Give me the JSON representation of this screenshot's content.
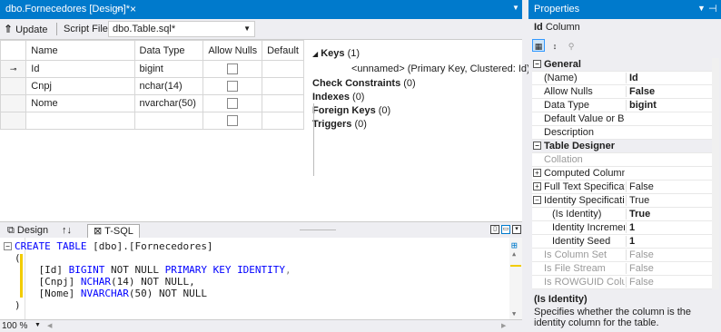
{
  "document_tab": {
    "label": "dbo.Fornecedores [Design]*",
    "pin_glyph": "⇔",
    "close_glyph": "×"
  },
  "toolbar": {
    "update_label": "Update",
    "script_file_label": "Script File:",
    "script_file_value": "dbo.Table.sql*"
  },
  "grid": {
    "columns": [
      "Name",
      "Data Type",
      "Allow Nulls",
      "Default"
    ],
    "rows": [
      {
        "name": "Id",
        "type": "bigint",
        "key": true
      },
      {
        "name": "Cnpj",
        "type": "nchar(14)",
        "key": false
      },
      {
        "name": "Nome",
        "type": "nvarchar(50)",
        "key": false
      },
      {
        "name": "",
        "type": "",
        "key": false
      }
    ]
  },
  "table_props": {
    "keys_label": "Keys",
    "keys_count": "(1)",
    "key_item": "<unnamed>   (Primary Key, Clustered: Id)",
    "check_label": "Check Constraints",
    "check_count": "(0)",
    "indexes_label": "Indexes",
    "indexes_count": "(0)",
    "fk_label": "Foreign Keys",
    "fk_count": "(0)",
    "triggers_label": "Triggers",
    "triggers_count": "(0)"
  },
  "pane_tabs": {
    "design": "Design",
    "swap": "↑↓",
    "tsql": "T-SQL"
  },
  "code": {
    "line1_kw": "CREATE TABLE",
    "line1_rest": " [dbo].[Fornecedores]",
    "line2": "(",
    "line3_a": "    [Id] ",
    "line3_kw": "BIGINT",
    "line3_b": " NOT NULL ",
    "line3_kw2": "PRIMARY KEY IDENTITY",
    "line3_c": ",",
    "line4_a": "    [Cnpj] ",
    "line4_kw": "NCHAR",
    "line4_b": "(14) NOT NULL,",
    "line5_a": "    [Nome] ",
    "line5_kw": "NVARCHAR",
    "line5_b": "(50) NOT NULL",
    "line6": ")"
  },
  "status": {
    "zoom": "100 %"
  },
  "properties": {
    "title": "Properties",
    "object_name": "Id",
    "object_type": "Column",
    "rows": [
      {
        "kind": "cat",
        "name": "General"
      },
      {
        "kind": "prop",
        "name": "(Name)",
        "value": "Id",
        "style": "bold"
      },
      {
        "kind": "prop",
        "name": "Allow Nulls",
        "value": "False",
        "style": "bold"
      },
      {
        "kind": "prop",
        "name": "Data Type",
        "value": "bigint",
        "style": "bold"
      },
      {
        "kind": "prop",
        "name": "Default Value or Binding",
        "value": "",
        "style": ""
      },
      {
        "kind": "prop",
        "name": "Description",
        "value": "",
        "style": ""
      },
      {
        "kind": "cat",
        "name": "Table Designer"
      },
      {
        "kind": "prop",
        "name": "Collation",
        "value": "",
        "style": "dim"
      },
      {
        "kind": "exp",
        "name": "Computed Column Specification",
        "value": "",
        "style": ""
      },
      {
        "kind": "exp",
        "name": "Full Text Specification",
        "value": "False",
        "style": ""
      },
      {
        "kind": "expopen",
        "name": "Identity Specification",
        "value": "True",
        "style": ""
      },
      {
        "kind": "sub",
        "name": "(Is Identity)",
        "value": "True",
        "style": "bold"
      },
      {
        "kind": "sub",
        "name": "Identity Increment",
        "value": "1",
        "style": "bold"
      },
      {
        "kind": "sub",
        "name": "Identity Seed",
        "value": "1",
        "style": "bold"
      },
      {
        "kind": "prop",
        "name": "Is Column Set",
        "value": "False",
        "style": "dim"
      },
      {
        "kind": "prop",
        "name": "Is File Stream",
        "value": "False",
        "style": "dim"
      },
      {
        "kind": "prop",
        "name": "Is ROWGUID Column",
        "value": "False",
        "style": "dim"
      }
    ],
    "desc_title": "(Is Identity)",
    "desc_text": "Specifies whether the column is the identity column for the table."
  },
  "colors": {
    "accent": "#007acc",
    "keyword": "#0000ff",
    "indicator": "#f2cc00"
  }
}
